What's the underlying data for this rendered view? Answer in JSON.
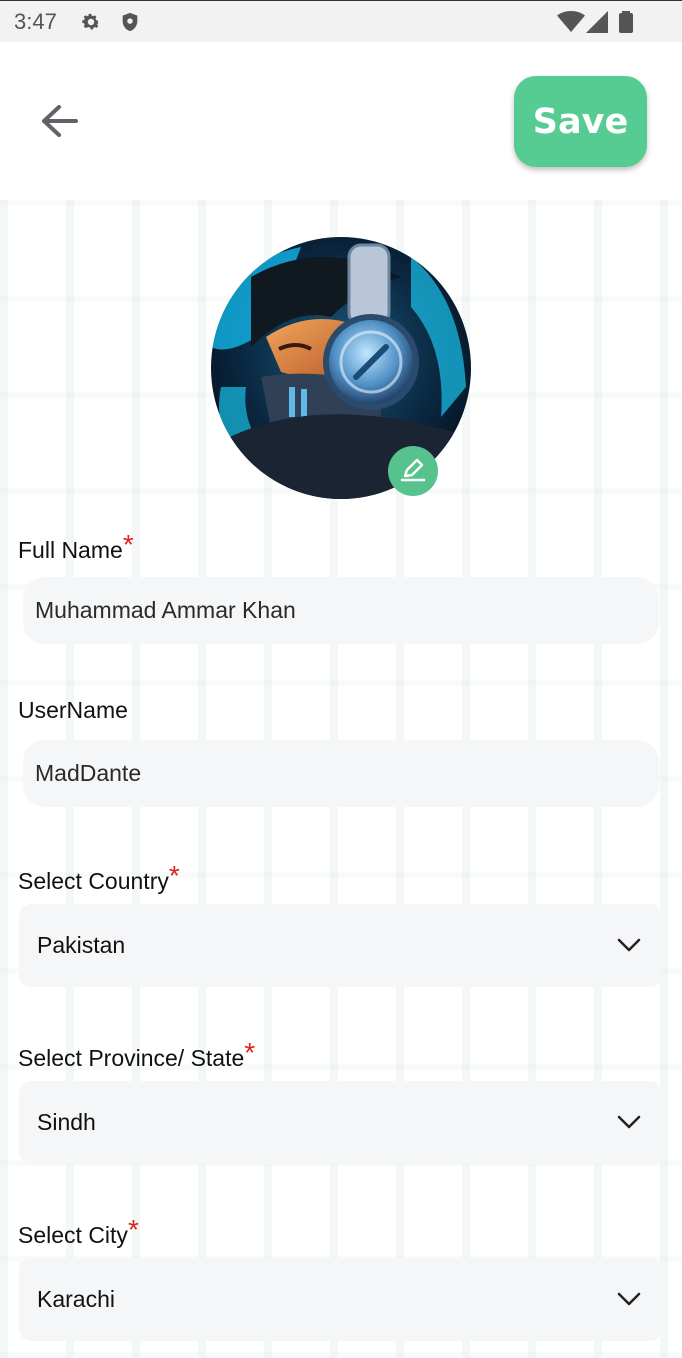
{
  "status_bar": {
    "time": "3:47",
    "icons": [
      "gear-icon",
      "shield-icon",
      "wifi-icon",
      "signal-icon",
      "battery-icon"
    ]
  },
  "header": {
    "back_icon": "arrow-left-icon",
    "save_label": "Save"
  },
  "colors": {
    "accent": "#56cc93",
    "required": "#e0211f",
    "field_bg": "#f5f6f8"
  },
  "profile": {
    "avatar_icon": "avatar-image",
    "edit_icon": "pencil-icon"
  },
  "form": {
    "full_name": {
      "label": "Full Name",
      "required_mark": "*",
      "value": "Muhammad Ammar Khan"
    },
    "username": {
      "label": "UserName",
      "value": "MadDante"
    },
    "country": {
      "label": "Select Country",
      "required_mark": "*",
      "value": "Pakistan"
    },
    "province": {
      "label": "Select Province/ State",
      "required_mark": "*",
      "value": "Sindh"
    },
    "city": {
      "label": "Select City",
      "required_mark": "*",
      "value": "Karachi"
    }
  }
}
